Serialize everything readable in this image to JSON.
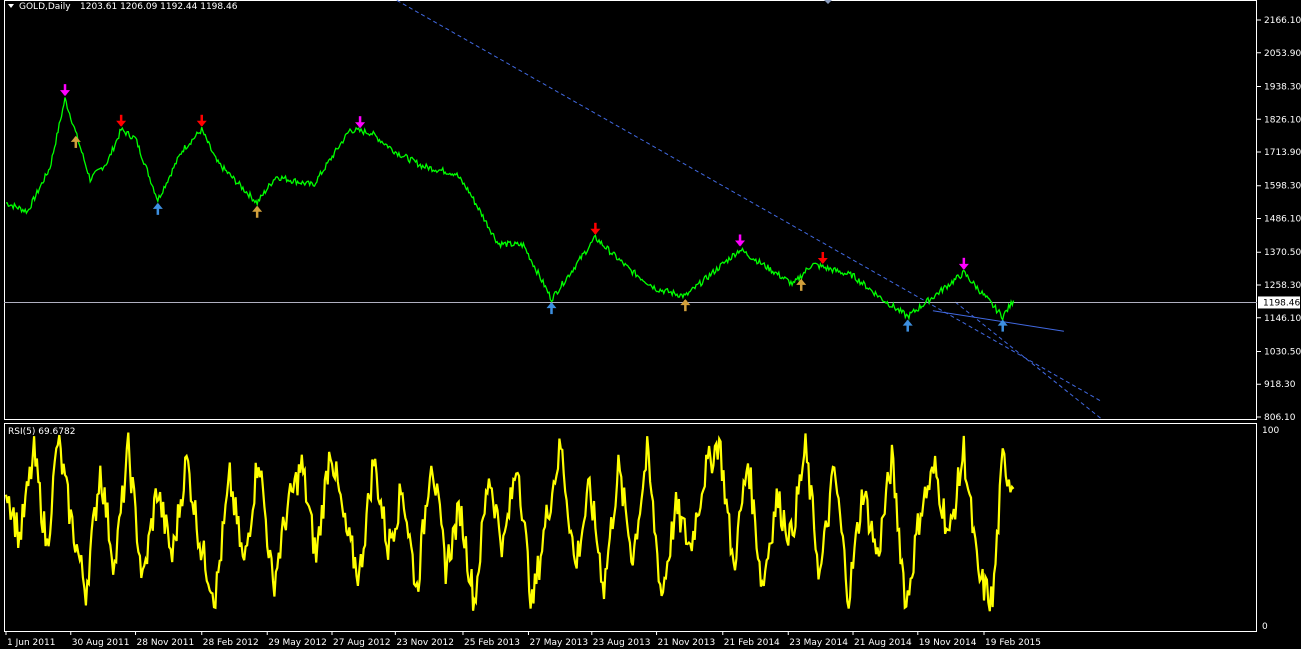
{
  "header": {
    "symbol": "GOLD,Daily",
    "ohlc": "1203.61 1206.09 1192.44 1198.46"
  },
  "rsi_header": "RSI(5) 69.6782",
  "colors": {
    "background": "#000000",
    "price_line": "#00ff00",
    "rsi_line": "#ffff00",
    "trendline": "#4169e1",
    "axis": "#ffffff",
    "marker_magenta": "#ff00ff",
    "marker_red": "#ff0000",
    "marker_orange": "#d2a03c",
    "marker_blue": "#3d8fe0"
  },
  "chart_data": [
    {
      "type": "line",
      "series": [
        {
          "name": "GOLD,Daily",
          "x": [
            "2011-06-01",
            "2011-07-01",
            "2011-08-01",
            "2011-08-22",
            "2011-08-30",
            "2011-09-26",
            "2011-10-20",
            "2011-11-08",
            "2011-11-28",
            "2011-12-29",
            "2012-02-01",
            "2012-02-28",
            "2012-03-20",
            "2012-05-15",
            "2012-06-10",
            "2012-08-01",
            "2012-09-21",
            "2012-10-20",
            "2012-11-23",
            "2012-12-31",
            "2013-02-15",
            "2013-03-05",
            "2013-04-15",
            "2013-05-20",
            "2013-06-28",
            "2013-08-28",
            "2013-10-15",
            "2013-11-21",
            "2013-12-31",
            "2014-02-21",
            "2014-03-17",
            "2014-05-30",
            "2014-06-25",
            "2014-07-10",
            "2014-08-21",
            "2014-10-01",
            "2014-11-05",
            "2015-01-22",
            "2015-03-17",
            "2015-04-01"
          ],
          "values": [
            1540,
            1510,
            1660,
            1895,
            1835,
            1620,
            1680,
            1790,
            1760,
            1550,
            1720,
            1790,
            1680,
            1540,
            1630,
            1600,
            1790,
            1780,
            1715,
            1665,
            1640,
            1580,
            1400,
            1395,
            1210,
            1420,
            1310,
            1245,
            1220,
            1330,
            1380,
            1260,
            1330,
            1320,
            1290,
            1210,
            1150,
            1300,
            1150,
            1205
          ]
        }
      ],
      "marker_points": [
        {
          "x": "2011-08-22",
          "direction": "down",
          "color": "magenta"
        },
        {
          "x": "2011-09-06",
          "direction": "up",
          "color": "orange"
        },
        {
          "x": "2011-11-08",
          "direction": "down",
          "color": "red"
        },
        {
          "x": "2011-12-29",
          "direction": "up",
          "color": "blue"
        },
        {
          "x": "2012-02-28",
          "direction": "down",
          "color": "red"
        },
        {
          "x": "2012-05-15",
          "direction": "up",
          "color": "orange"
        },
        {
          "x": "2012-10-05",
          "direction": "down",
          "color": "magenta"
        },
        {
          "x": "2013-06-28",
          "direction": "up",
          "color": "blue"
        },
        {
          "x": "2013-08-28",
          "direction": "down",
          "color": "red"
        },
        {
          "x": "2013-12-31",
          "direction": "up",
          "color": "orange"
        },
        {
          "x": "2014-03-17",
          "direction": "down",
          "color": "magenta"
        },
        {
          "x": "2014-06-10",
          "direction": "up",
          "color": "orange"
        },
        {
          "x": "2014-07-10",
          "direction": "down",
          "color": "red"
        },
        {
          "x": "2014-11-05",
          "direction": "up",
          "color": "blue"
        },
        {
          "x": "2015-01-22",
          "direction": "down",
          "color": "magenta"
        },
        {
          "x": "2015-03-17",
          "direction": "up",
          "color": "blue"
        }
      ],
      "trendlines": [
        {
          "x": [
            "2012-09-10",
            "2015-08-01"
          ],
          "values": [
            2340,
            860
          ],
          "style": "dashed"
        },
        {
          "x": [
            "2015-01-10",
            "2015-08-01"
          ],
          "values": [
            1200,
            800
          ],
          "style": "dashed"
        },
        {
          "x": [
            "2014-12-10",
            "2015-06-10"
          ],
          "values": [
            1170,
            1100
          ],
          "style": "solid"
        }
      ],
      "current_price_line": 1198.46,
      "current_price_label": "1198.46",
      "x_tick_labels": [
        "1 Jun 2011",
        "30 Aug 2011",
        "28 Nov 2011",
        "28 Feb 2012",
        "29 May 2012",
        "27 Aug 2012",
        "23 Nov 2012",
        "25 Feb 2013",
        "27 May 2013",
        "23 Aug 2013",
        "21 Nov 2013",
        "21 Feb 2014",
        "23 May 2014",
        "21 Aug 2014",
        "19 Nov 2014",
        "19 Feb 2015"
      ],
      "x_tick_dates": [
        "2011-06-01",
        "2011-08-30",
        "2011-11-28",
        "2012-02-28",
        "2012-05-29",
        "2012-08-27",
        "2012-11-23",
        "2013-02-25",
        "2013-05-27",
        "2013-08-23",
        "2013-11-21",
        "2014-02-21",
        "2014-05-23",
        "2014-08-21",
        "2014-11-19",
        "2015-02-19"
      ],
      "y_ticks": [
        2166.1,
        2053.9,
        1938.3,
        1826.1,
        1713.9,
        1598.3,
        1486.1,
        1370.5,
        1258.3,
        1146.1,
        1030.5,
        918.3,
        806.1
      ],
      "y_tick_labels": [
        "2166.10",
        "2053.90",
        "1938.30",
        "1826.10",
        "1713.90",
        "1598.30",
        "1486.10",
        "1370.50",
        "1258.30",
        "1146.10",
        "1030.50",
        "918.30",
        "806.10"
      ],
      "ylim": [
        780,
        2210
      ]
    },
    {
      "type": "line",
      "title": "RSI(5) 69.6782",
      "series": [
        {
          "name": "RSI(5)",
          "x": [
            "2011-06-01",
            "2011-06-20",
            "2011-07-10",
            "2011-07-28",
            "2011-08-12",
            "2011-08-30",
            "2011-09-20",
            "2011-10-10",
            "2011-10-30",
            "2011-11-18",
            "2011-12-08",
            "2011-12-28",
            "2012-01-18",
            "2012-02-07",
            "2012-02-27",
            "2012-03-18",
            "2012-04-07",
            "2012-04-27",
            "2012-05-17",
            "2012-06-06",
            "2012-06-26",
            "2012-07-16",
            "2012-08-05",
            "2012-08-25",
            "2012-09-14",
            "2012-10-04",
            "2012-10-24",
            "2012-11-13",
            "2012-12-03",
            "2012-12-23",
            "2013-01-12",
            "2013-02-01",
            "2013-02-21",
            "2013-03-13",
            "2013-04-02",
            "2013-04-22",
            "2013-05-12",
            "2013-06-01",
            "2013-06-21",
            "2013-07-11",
            "2013-07-31",
            "2013-08-20",
            "2013-09-09",
            "2013-09-29",
            "2013-10-19",
            "2013-11-08",
            "2013-11-28",
            "2013-12-18",
            "2014-01-07",
            "2014-01-27",
            "2014-02-16",
            "2014-03-08",
            "2014-03-28",
            "2014-04-17",
            "2014-05-07",
            "2014-05-27",
            "2014-06-16",
            "2014-07-06",
            "2014-07-26",
            "2014-08-15",
            "2014-09-04",
            "2014-09-24",
            "2014-10-14",
            "2014-11-03",
            "2014-11-23",
            "2014-12-13",
            "2015-01-02",
            "2015-01-22",
            "2015-02-11",
            "2015-03-03",
            "2015-03-17",
            "2015-04-01"
          ],
          "values": [
            72,
            45,
            88,
            40,
            95,
            55,
            18,
            80,
            30,
            90,
            22,
            70,
            35,
            85,
            40,
            15,
            75,
            30,
            88,
            20,
            60,
            82,
            35,
            92,
            50,
            25,
            85,
            40,
            70,
            18,
            88,
            30,
            60,
            12,
            78,
            40,
            85,
            10,
            55,
            92,
            30,
            70,
            20,
            80,
            35,
            88,
            15,
            60,
            40,
            78,
            95,
            30,
            85,
            20,
            65,
            45,
            90,
            25,
            80,
            15,
            70,
            35,
            85,
            10,
            60,
            80,
            45,
            90,
            25,
            12,
            85,
            70
          ]
        }
      ],
      "ylim": [
        0,
        100
      ],
      "y_tick_labels": [
        "100",
        "0"
      ]
    }
  ]
}
